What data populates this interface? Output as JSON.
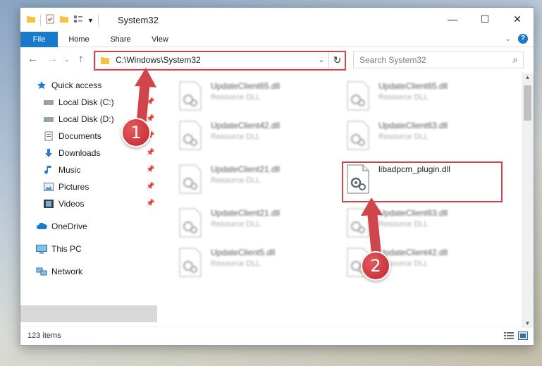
{
  "window": {
    "title": "System32",
    "controls": {
      "minimize": "—",
      "maximize": "☐",
      "close": "✕"
    }
  },
  "ribbon": {
    "tabs": [
      {
        "label": "File"
      },
      {
        "label": "Home"
      },
      {
        "label": "Share"
      },
      {
        "label": "View"
      }
    ],
    "help": "?"
  },
  "nav": {
    "address": "C:\\Windows\\System32",
    "search_placeholder": "Search System32"
  },
  "sidebar": {
    "items": [
      {
        "label": "Quick access",
        "icon": "star-icon",
        "pinned": false
      },
      {
        "label": "Local Disk (C:)",
        "icon": "drive-icon",
        "pinned": true
      },
      {
        "label": "Local Disk (D:)",
        "icon": "drive-icon",
        "pinned": true
      },
      {
        "label": "Documents",
        "icon": "documents-icon",
        "pinned": true
      },
      {
        "label": "Downloads",
        "icon": "download-icon",
        "pinned": true
      },
      {
        "label": "Music",
        "icon": "music-icon",
        "pinned": true
      },
      {
        "label": "Pictures",
        "icon": "pictures-icon",
        "pinned": true
      },
      {
        "label": "Videos",
        "icon": "videos-icon",
        "pinned": true
      },
      {
        "label": "OneDrive",
        "icon": "cloud-icon",
        "pinned": false
      },
      {
        "label": "This PC",
        "icon": "computer-icon",
        "pinned": false,
        "selected": true
      },
      {
        "label": "Network",
        "icon": "network-icon",
        "pinned": false
      }
    ]
  },
  "files": [
    {
      "name": "UpdateClient65.dll",
      "type": "Resource DLL"
    },
    {
      "name": "UpdateClient65.dll",
      "type": "Resource DLL"
    },
    {
      "name": "UpdateClient42.dll",
      "type": "Resource DLL"
    },
    {
      "name": "UpdateClient63.dll",
      "type": "Resource DLL"
    },
    {
      "name": "UpdateClient21.dll",
      "type": "Resource DLL"
    },
    {
      "name": "libadpcm_plugin.dll",
      "type": ""
    },
    {
      "name": "UpdateClient21.dll",
      "type": "Resource DLL"
    },
    {
      "name": "UpdateClient63.dll",
      "type": "Resource DLL"
    },
    {
      "name": "UpdateClient5.dll",
      "type": "Resource DLL"
    },
    {
      "name": "UpdateClient42.dll",
      "type": "Resource DLL"
    }
  ],
  "status": {
    "item_count": "123 items"
  },
  "annotations": {
    "step1": "1",
    "step2": "2",
    "accent": "#d0454c"
  },
  "colors": {
    "accent": "#1979ca",
    "highlight": "#d0454c"
  }
}
